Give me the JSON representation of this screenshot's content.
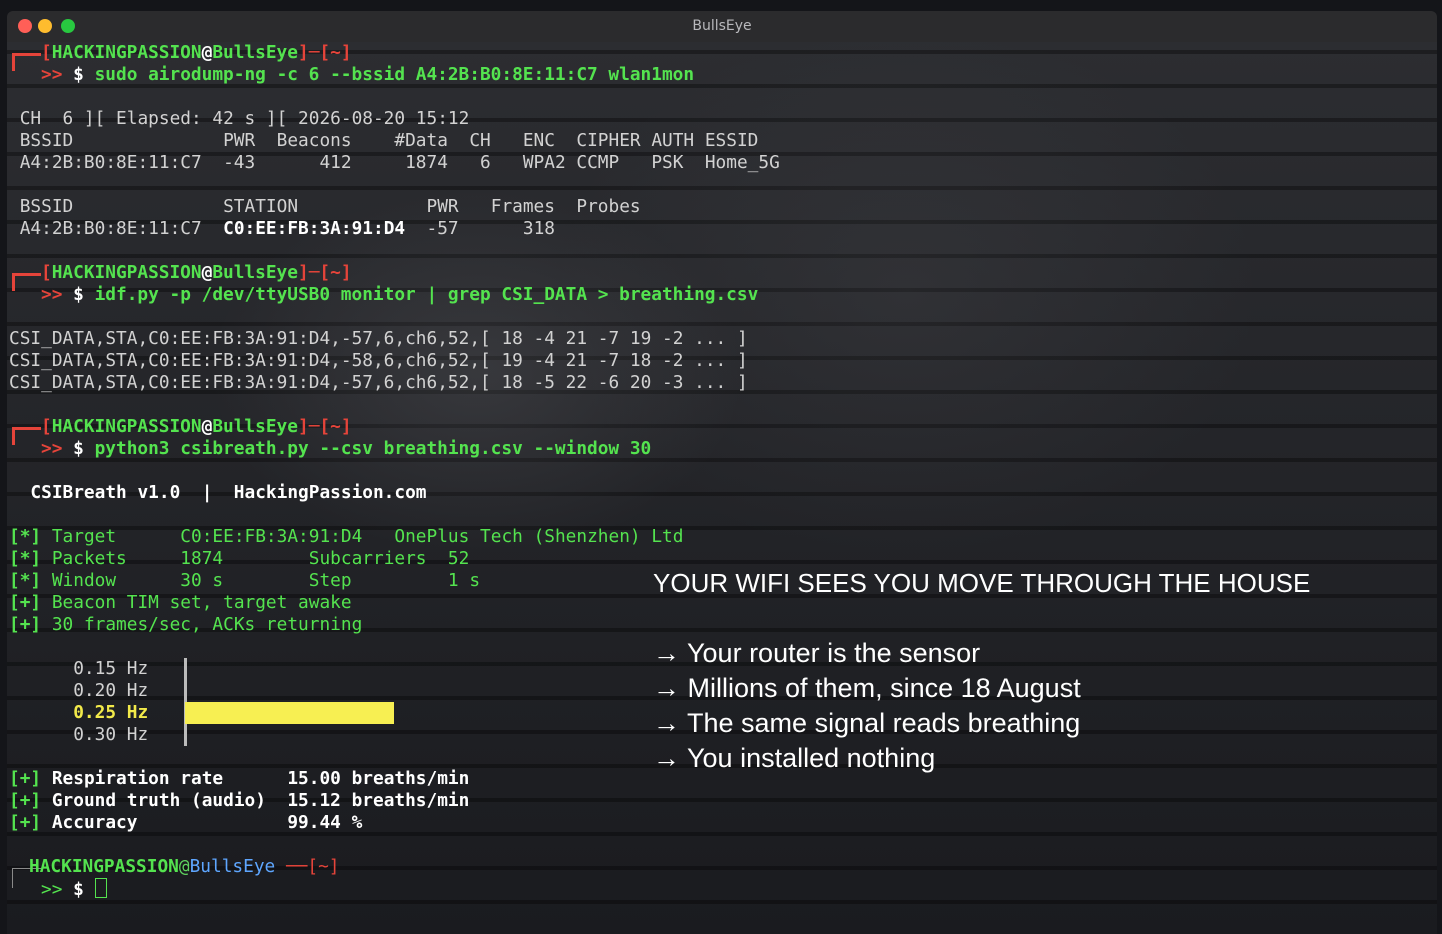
{
  "window": {
    "title": "BullsEye"
  },
  "prompt": {
    "user": "HACKINGPASSION",
    "at": "@",
    "host": "BullsEye",
    "open": "]",
    "dash": "─",
    "dir": "[~]",
    "arrow": ">>",
    "dollar": "$",
    "last_dash": " ──"
  },
  "cmd1": "sudo airodump-ng -c 6 --bssid A4:2B:B0:8E:11:C7 wlan1mon",
  "airodump": {
    "status": " CH  6 ][ Elapsed: 42 s ][ 2026-08-20 15:12",
    "ap_header": " BSSID              PWR  Beacons    #Data  CH   ENC  CIPHER AUTH ESSID",
    "ap_row": " A4:2B:B0:8E:11:C7  -43      412     1874   6   WPA2 CCMP   PSK  Home_5G",
    "sta_header": " BSSID              STATION            PWR   Frames  Probes",
    "sta_bssid": " A4:2B:B0:8E:11:C7  ",
    "sta_station": "C0:EE:FB:3A:91:D4",
    "sta_rest": "  -57      318"
  },
  "cmd2": "idf.py -p /dev/ttyUSB0 monitor | grep CSI_DATA > breathing.csv",
  "csi_lines": [
    "CSI_DATA,STA,C0:EE:FB:3A:91:D4,-57,6,ch6,52,[ 18 -4 21 -7 19 -2 ... ]",
    "CSI_DATA,STA,C0:EE:FB:3A:91:D4,-58,6,ch6,52,[ 19 -4 21 -7 18 -2 ... ]",
    "CSI_DATA,STA,C0:EE:FB:3A:91:D4,-57,6,ch6,52,[ 18 -5 22 -6 20 -3 ... ]"
  ],
  "cmd3": "python3 csibreath.py --csv breathing.csv --window 30",
  "banner": "  CSIBreath v1.0  |  HackingPassion.com",
  "info": {
    "star": "[*]",
    "plus": "[+]",
    "target": " Target      C0:EE:FB:3A:91:D4   OnePlus Tech (Shenzhen) Ltd",
    "packets": " Packets     1874        Subcarriers  52",
    "window": " Window      30 s        Step         1 s",
    "beacon": " Beacon TIM set, target awake",
    "frames": " 30 frames/sec, ACKs returning"
  },
  "freq": [
    {
      "label": "      0.15 Hz",
      "level": 0,
      "highlight": false
    },
    {
      "label": "      0.20 Hz",
      "level": 0,
      "highlight": false
    },
    {
      "label": "      0.25 Hz",
      "level": 1,
      "highlight": true
    },
    {
      "label": "      0.30 Hz",
      "level": 0,
      "highlight": false
    }
  ],
  "results": {
    "prefix": "[+]",
    "resp": " Respiration rate      15.00 breaths/min",
    "truth": " Ground truth (audio)  15.12 breaths/min",
    "accuracy": " Accuracy              99.44 %"
  },
  "overlay": {
    "headline": "YOUR WIFI SEES YOU MOVE THROUGH THE HOUSE",
    "items": [
      "→ Your router is the sensor",
      "→ Millions of them, since 18 August",
      "→ The same signal reads breathing",
      "→ You installed nothing"
    ]
  },
  "colors": {
    "prompt_green": "#54e34f",
    "prompt_red": "#e5443a",
    "prompt_blue": "#5ea6ff",
    "bar_yellow": "#f7ef52"
  }
}
